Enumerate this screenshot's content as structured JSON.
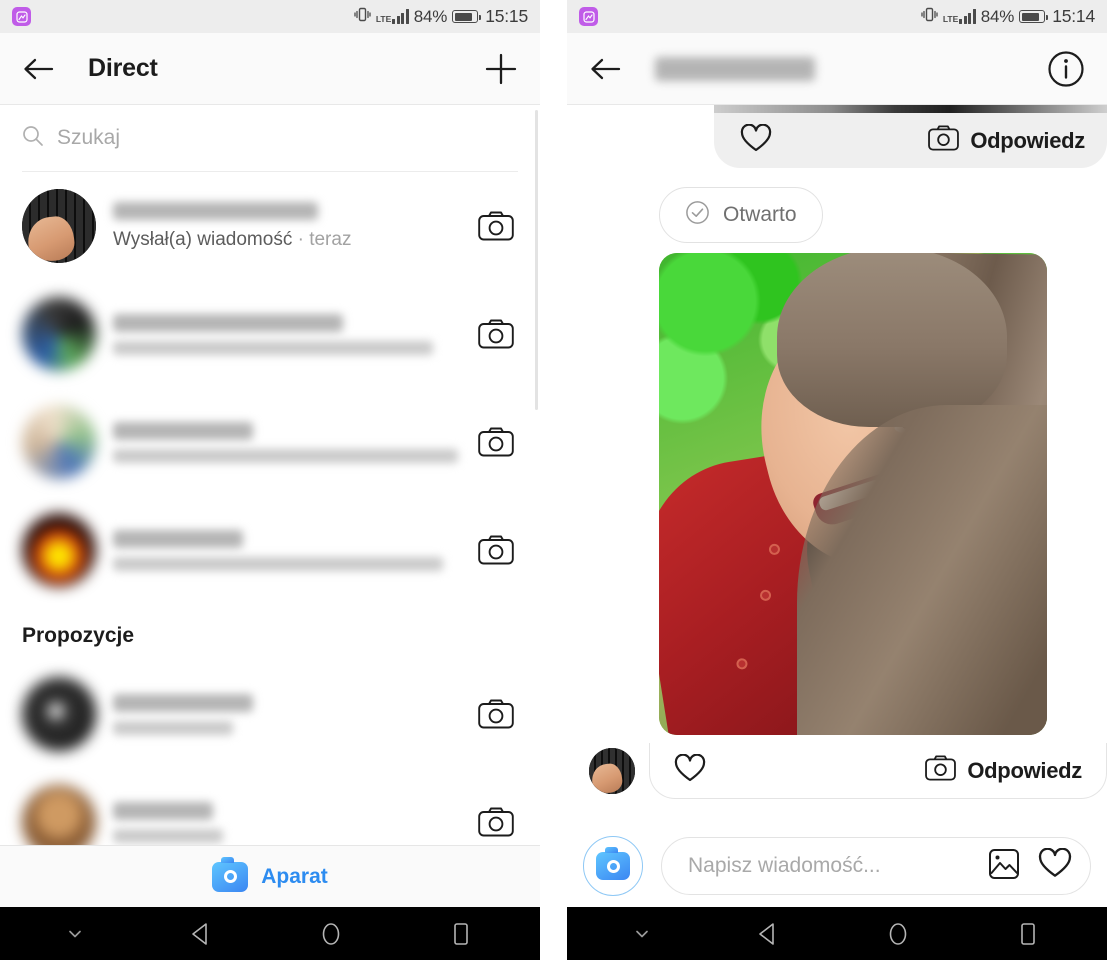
{
  "left_phone": {
    "status_bar": {
      "app_icon": "instagram-notification-icon",
      "network": "LTE",
      "battery_percent": "84%",
      "clock": "15:15"
    },
    "app_bar": {
      "back_icon": "back-arrow-icon",
      "title": "Direct",
      "new_message_icon": "plus-icon"
    },
    "search": {
      "icon": "search-icon",
      "placeholder": "Szukaj"
    },
    "conversations": [
      {
        "avatar": "keyboard-hand-photo",
        "name_hidden": true,
        "preview": "Wysłał(a) wiadomość",
        "separator": "·",
        "time": "teraz",
        "camera_icon": "camera-icon"
      },
      {
        "avatar": "group-photo",
        "name_hidden": true,
        "preview_hidden": true,
        "camera_icon": "camera-icon"
      },
      {
        "avatar": "person-photo",
        "name_hidden": true,
        "preview_hidden": true,
        "camera_icon": "camera-icon"
      },
      {
        "avatar": "dark-photo",
        "name_hidden": true,
        "preview_hidden": true,
        "camera_icon": "camera-icon"
      }
    ],
    "suggestions": {
      "header": "Propozycje",
      "items": [
        {
          "avatar": "music-photo",
          "name_hidden": true,
          "sub_hidden": true,
          "camera_icon": "camera-icon"
        },
        {
          "avatar": "brown-photo",
          "name_hidden": true,
          "sub_hidden": true,
          "camera_icon": "camera-icon"
        }
      ]
    },
    "camera_footer": {
      "icon": "camera-icon-blue",
      "label": "Aparat",
      "accent_color": "#2d8cf0"
    }
  },
  "right_phone": {
    "status_bar": {
      "app_icon": "instagram-notification-icon",
      "network": "LTE",
      "battery_percent": "84%",
      "clock": "15:14"
    },
    "app_bar": {
      "back_icon": "back-arrow-icon",
      "title_hidden": true,
      "info_icon": "info-circle-icon"
    },
    "previous_message": {
      "heart_icon": "heart-icon",
      "camera_icon": "camera-icon",
      "reply_label": "Odpowiedz"
    },
    "status_chip": {
      "icon": "check-circle-icon",
      "label": "Otwarto"
    },
    "photo_message": {
      "description": "woman-smiling-red-shirt-photo"
    },
    "message_actions": {
      "avatar": "keyboard-hand-photo",
      "heart_icon": "heart-icon",
      "camera_icon": "camera-icon",
      "reply_label": "Odpowiedz",
      "highlight_color": "#ec0000"
    },
    "composer": {
      "camera_icon": "camera-icon-blue",
      "placeholder": "Napisz wiadomość...",
      "gallery_icon": "image-icon",
      "heart_icon": "heart-icon"
    }
  },
  "nav_bar": {
    "hide_icon": "chevron-down-icon",
    "back_icon": "triangle-back-icon",
    "home_icon": "circle-home-icon",
    "recents_icon": "square-recents-icon"
  }
}
